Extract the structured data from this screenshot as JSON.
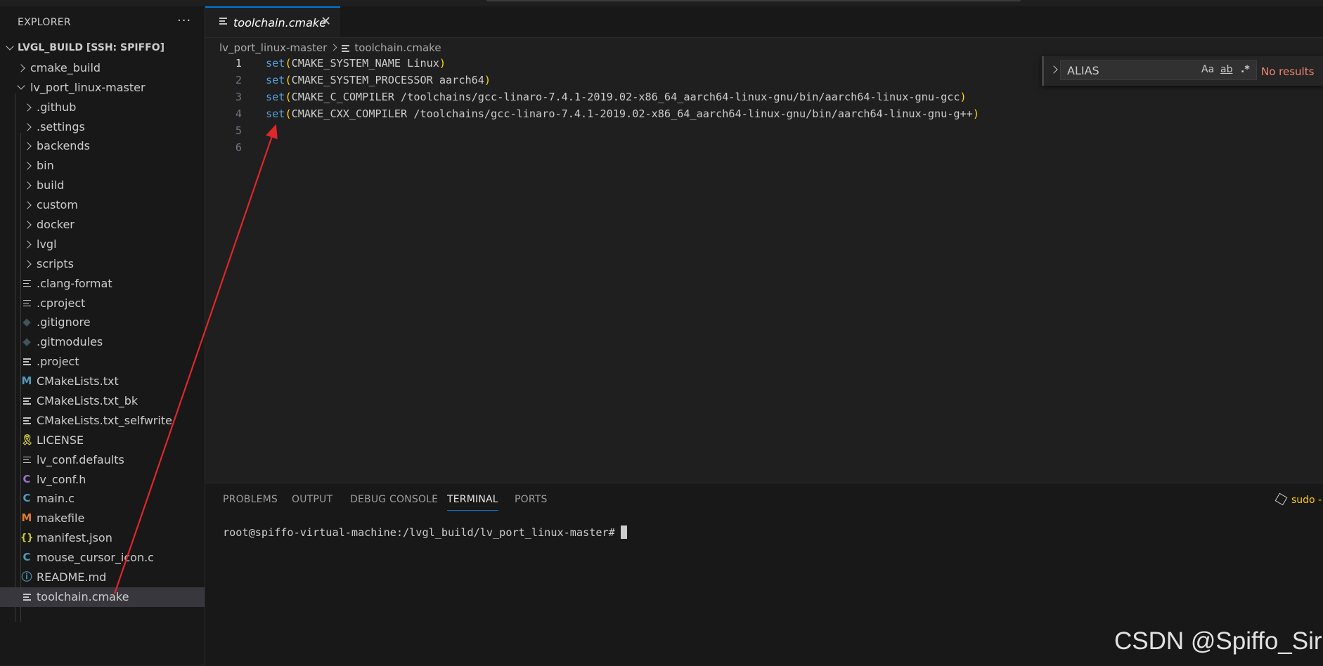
{
  "explorer": {
    "title": "EXPLORER",
    "more_label": "···",
    "root": "LVGL_BUILD [SSH: SPIFFO]",
    "items": [
      {
        "label": "cmake_build",
        "kind": "folder",
        "depth": 1
      },
      {
        "label": "lv_port_linux-master",
        "kind": "folder-open",
        "depth": 1
      },
      {
        "label": ".github",
        "kind": "folder",
        "depth": 2
      },
      {
        "label": ".settings",
        "kind": "folder",
        "depth": 2
      },
      {
        "label": "backends",
        "kind": "folder",
        "depth": 2
      },
      {
        "label": "bin",
        "kind": "folder",
        "depth": 2
      },
      {
        "label": "build",
        "kind": "folder",
        "depth": 2
      },
      {
        "label": "custom",
        "kind": "folder",
        "depth": 2
      },
      {
        "label": "docker",
        "kind": "folder",
        "depth": 2
      },
      {
        "label": "lvgl",
        "kind": "folder",
        "depth": 2
      },
      {
        "label": "scripts",
        "kind": "folder",
        "depth": 2
      },
      {
        "label": ".clang-format",
        "kind": "lines-icon",
        "depth": 2
      },
      {
        "label": ".cproject",
        "kind": "lines-icon",
        "depth": 2
      },
      {
        "label": ".gitignore",
        "kind": "git-icon",
        "depth": 2
      },
      {
        "label": ".gitmodules",
        "kind": "git-icon",
        "depth": 2
      },
      {
        "label": ".project",
        "kind": "lines-icon",
        "depth": 2
      },
      {
        "label": "CMakeLists.txt",
        "kind": "cmake-m-icon",
        "depth": 2
      },
      {
        "label": "CMakeLists.txt_bk",
        "kind": "lines-icon",
        "depth": 2
      },
      {
        "label": "CMakeLists.txt_selfwrite",
        "kind": "lines-icon",
        "depth": 2
      },
      {
        "label": "LICENSE",
        "kind": "license-icon",
        "depth": 2
      },
      {
        "label": "lv_conf.defaults",
        "kind": "lines-icon",
        "depth": 2
      },
      {
        "label": "lv_conf.h",
        "kind": "c-header-icon",
        "depth": 2
      },
      {
        "label": "main.c",
        "kind": "c-icon",
        "depth": 2
      },
      {
        "label": "makefile",
        "kind": "makefile-m-icon",
        "depth": 2
      },
      {
        "label": "manifest.json",
        "kind": "json-icon",
        "depth": 2
      },
      {
        "label": "mouse_cursor_icon.c",
        "kind": "c-icon",
        "depth": 2
      },
      {
        "label": "README.md",
        "kind": "info-icon",
        "depth": 2
      },
      {
        "label": "toolchain.cmake",
        "kind": "lines-icon",
        "depth": 2,
        "selected": true
      }
    ]
  },
  "editor": {
    "tab_label": "toolchain.cmake",
    "tab_close": "✕",
    "breadcrumb": [
      "lv_port_linux-master",
      "toolchain.cmake"
    ],
    "lines": [
      {
        "num": "1",
        "kw": "set",
        "open": "(",
        "body": "CMAKE_SYSTEM_NAME Linux",
        "close": ")"
      },
      {
        "num": "2",
        "kw": "set",
        "open": "(",
        "body": "CMAKE_SYSTEM_PROCESSOR aarch64",
        "close": ")"
      },
      {
        "num": "3",
        "kw": "set",
        "open": "(",
        "body": "CMAKE_C_COMPILER /toolchains/gcc-linaro-7.4.1-2019.02-x86_64_aarch64-linux-gnu/bin/aarch64-linux-gnu-gcc",
        "close": ")"
      },
      {
        "num": "4",
        "kw": "set",
        "open": "(",
        "body": "CMAKE_CXX_COMPILER /toolchains/gcc-linaro-7.4.1-2019.02-x86_64_aarch64-linux-gnu/bin/aarch64-linux-gnu-g++",
        "close": ")"
      },
      {
        "num": "5",
        "kw": "",
        "open": "",
        "body": "",
        "close": ""
      },
      {
        "num": "6",
        "kw": "",
        "open": "",
        "body": "",
        "close": ""
      }
    ],
    "active_line": "1",
    "find": {
      "value": "ALIAS",
      "match_case": "Aa",
      "whole_word": "ab",
      "regex": ".*",
      "status": "No results"
    }
  },
  "panel": {
    "tabs": [
      "PROBLEMS",
      "OUTPUT",
      "DEBUG CONSOLE",
      "TERMINAL",
      "PORTS"
    ],
    "active_tab": "TERMINAL",
    "shell_label": "sudo -",
    "prompt": "root@spiffo-virtual-machine:/lvgl_build/lv_port_linux-master#"
  },
  "watermark": "CSDN @Spiffo_Sir",
  "colors": {
    "accent": "#0078d4",
    "annotation_arrow": "#e0262b",
    "keyword": "#569cd6",
    "paren": "#ffd700",
    "no_results": "#f48771"
  }
}
